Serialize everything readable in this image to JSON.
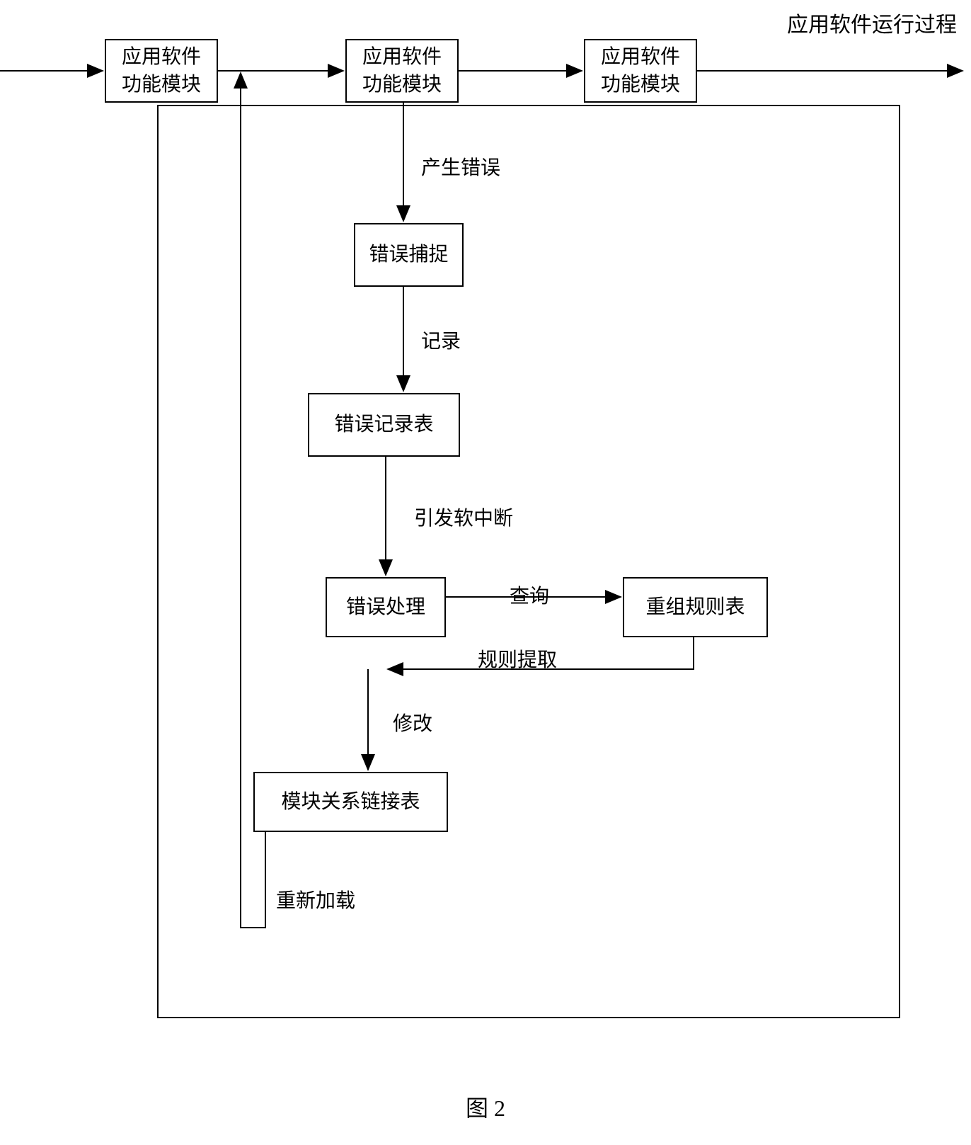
{
  "title": "应用软件运行过程",
  "boxes": {
    "module1": "应用软件\n功能模块",
    "module2": "应用软件\n功能模块",
    "module3": "应用软件\n功能模块",
    "error_capture": "错误捕捉",
    "error_record": "错误记录表",
    "error_handle": "错误处理",
    "reorg_rule": "重组规则表",
    "module_link": "模块关系链接表"
  },
  "labels": {
    "generate_error": "产生错误",
    "record": "记录",
    "trigger_interrupt": "引发软中断",
    "query": "查询",
    "rule_extract": "规则提取",
    "modify": "修改",
    "reload": "重新加载"
  },
  "caption": "图 2"
}
